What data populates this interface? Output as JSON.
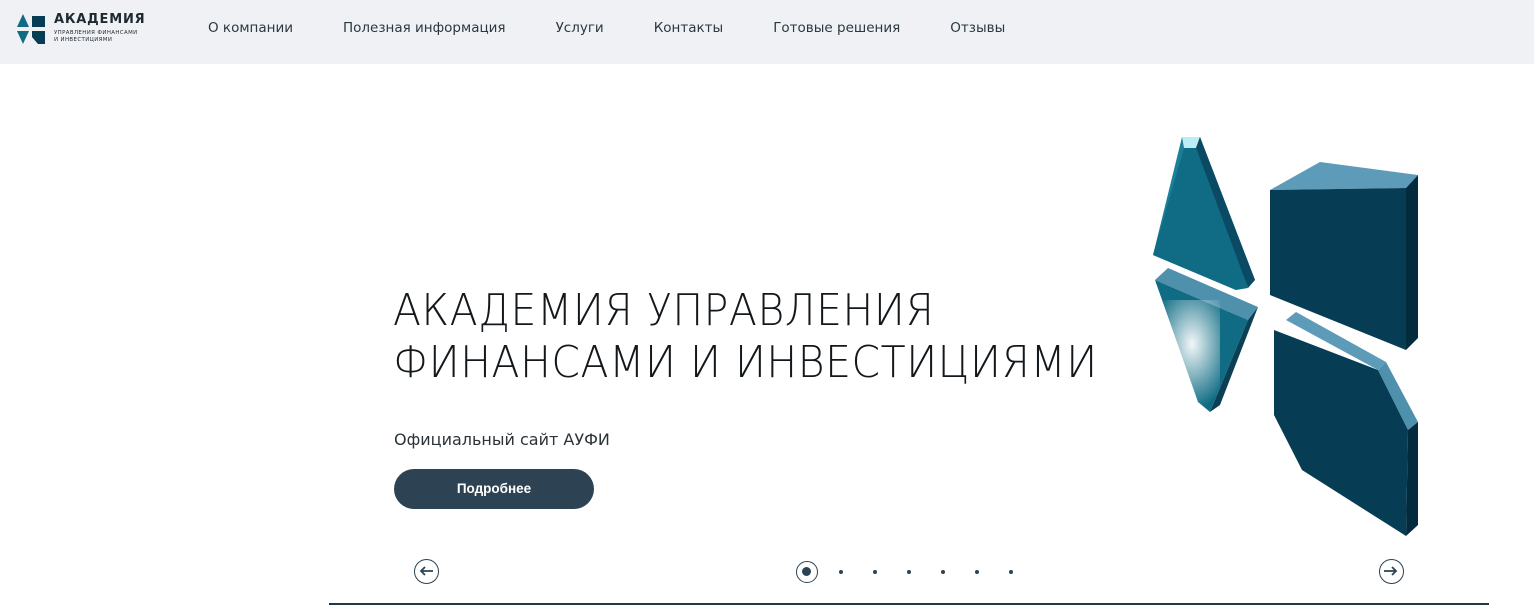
{
  "header": {
    "logo": {
      "title": "АКАДЕМИЯ",
      "subtitle_line1": "УПРАВЛЕНИЯ ФИНАНСАМИ",
      "subtitle_line2": "И ИНВЕСТИЦИЯМИ"
    },
    "nav": [
      {
        "label": "О компании"
      },
      {
        "label": "Полезная информация"
      },
      {
        "label": "Услуги"
      },
      {
        "label": "Контакты"
      },
      {
        "label": "Готовые решения"
      },
      {
        "label": "Отзывы"
      }
    ]
  },
  "hero": {
    "title_line1": "АКАДЕМИЯ УПРАВЛЕНИЯ",
    "title_line2": "ФИНАНСАМИ И ИНВЕСТИЦИЯМИ",
    "subtitle": "Официальный сайт АУФИ",
    "button_label": "Подробнее"
  },
  "slider": {
    "total_slides": 7,
    "active_slide": 1,
    "prev_icon": "arrow-left-icon",
    "next_icon": "arrow-right-icon"
  },
  "colors": {
    "header_bg": "#eff1f5",
    "accent": "#2d4252",
    "emblem_teal": "#0f6c84",
    "emblem_dark": "#063c54"
  }
}
